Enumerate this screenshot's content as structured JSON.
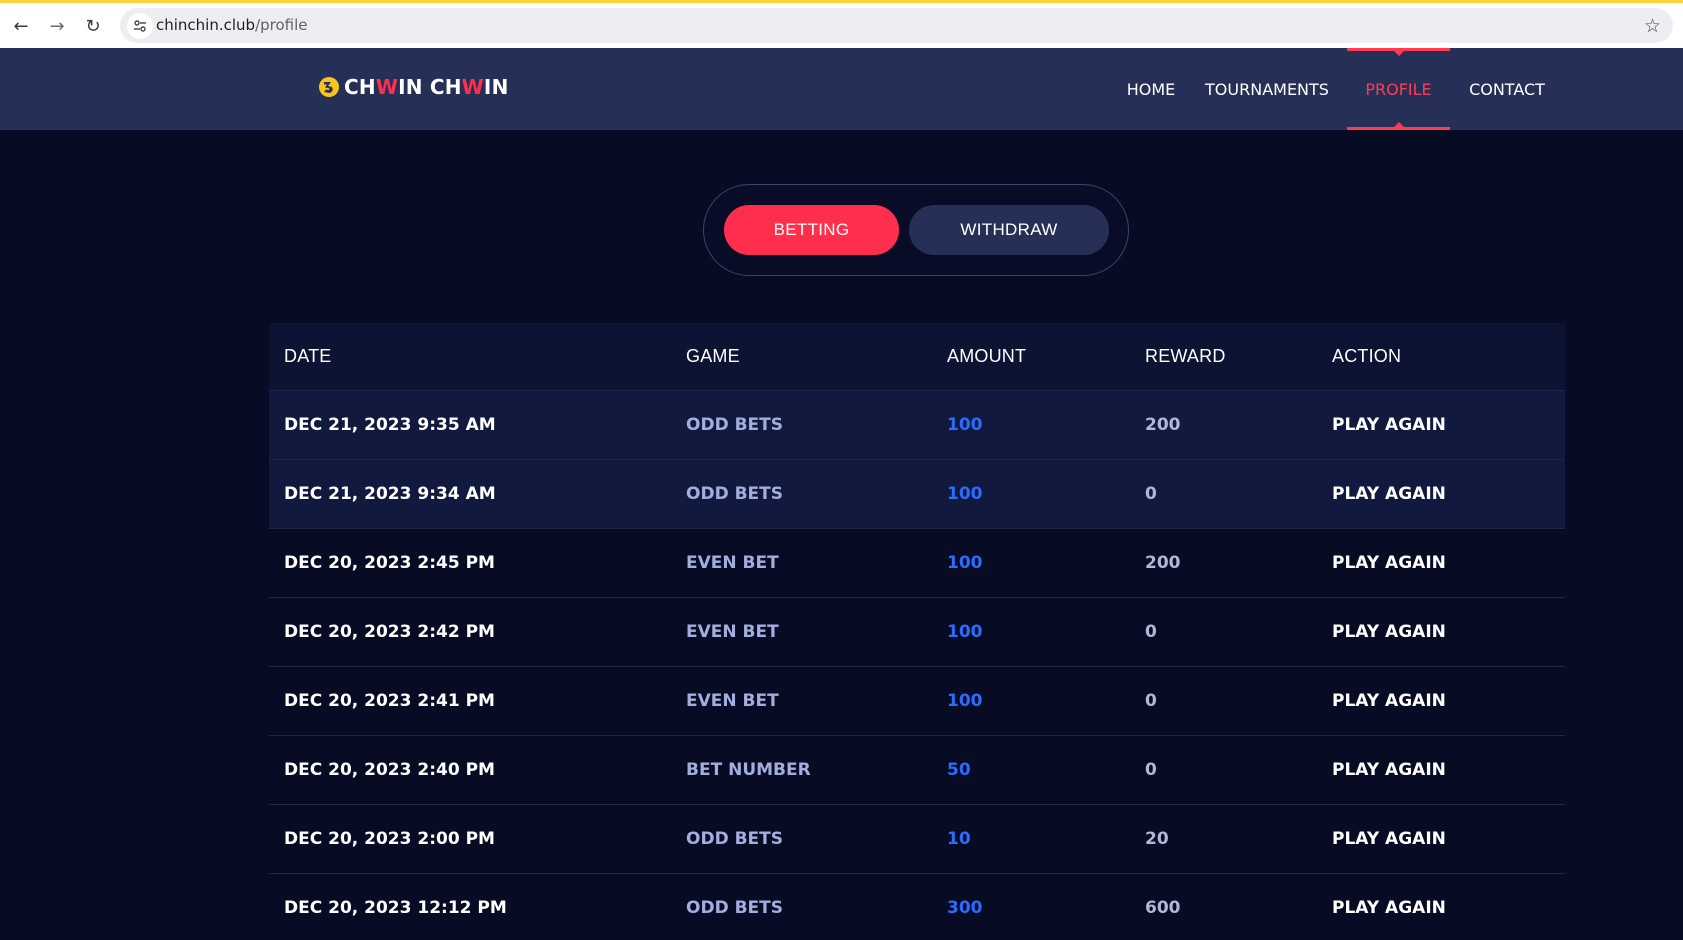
{
  "browser": {
    "url_host": "chinchin.club",
    "url_path": "/profile"
  },
  "site": {
    "logo_parts": [
      "CH",
      "W",
      "IN CH",
      "W",
      "IN"
    ],
    "nav": [
      {
        "label": "HOME",
        "active": false
      },
      {
        "label": "TOURNAMENTS",
        "active": false
      },
      {
        "label": "PROFILE",
        "active": true
      },
      {
        "label": "CONTACT",
        "active": false
      }
    ]
  },
  "toggle": {
    "betting": "BETTING",
    "withdraw": "WITHDRAW",
    "selected": "betting"
  },
  "table": {
    "headers": {
      "date": "DATE",
      "game": "GAME",
      "amount": "AMOUNT",
      "reward": "REWARD",
      "action": "ACTION"
    },
    "rows": [
      {
        "date": "DEC 21, 2023 9:35 AM",
        "game": "ODD BETS",
        "amount": "100",
        "reward": "200",
        "action": "PLAY AGAIN"
      },
      {
        "date": "DEC 21, 2023 9:34 AM",
        "game": "ODD BETS",
        "amount": "100",
        "reward": "0",
        "action": "PLAY AGAIN"
      },
      {
        "date": "DEC 20, 2023 2:45 PM",
        "game": "EVEN BET",
        "amount": "100",
        "reward": "200",
        "action": "PLAY AGAIN"
      },
      {
        "date": "DEC 20, 2023 2:42 PM",
        "game": "EVEN BET",
        "amount": "100",
        "reward": "0",
        "action": "PLAY AGAIN"
      },
      {
        "date": "DEC 20, 2023 2:41 PM",
        "game": "EVEN BET",
        "amount": "100",
        "reward": "0",
        "action": "PLAY AGAIN"
      },
      {
        "date": "DEC 20, 2023 2:40 PM",
        "game": "BET NUMBER",
        "amount": "50",
        "reward": "0",
        "action": "PLAY AGAIN"
      },
      {
        "date": "DEC 20, 2023 2:00 PM",
        "game": "ODD BETS",
        "amount": "10",
        "reward": "20",
        "action": "PLAY AGAIN"
      },
      {
        "date": "DEC 20, 2023 12:12 PM",
        "game": "ODD BETS",
        "amount": "300",
        "reward": "600",
        "action": "PLAY AGAIN"
      }
    ]
  },
  "colors": {
    "accent": "#ff2e4c",
    "header_bg": "#263057",
    "page_bg": "#070b24",
    "amount_blue": "#2b6cff"
  }
}
